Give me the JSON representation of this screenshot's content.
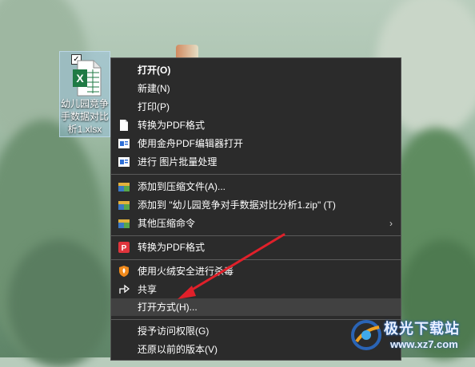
{
  "desktop": {
    "file_name": "幼儿园竞争对手数据对比分析1.xlsx",
    "file_name_lines": [
      "幼儿园竞争",
      "手数据对比",
      "析1.xlsx"
    ],
    "selected_check": "✓"
  },
  "menu": {
    "items": [
      {
        "label": "打开(O)",
        "icon": "none"
      },
      {
        "label": "新建(N)",
        "icon": "none"
      },
      {
        "label": "打印(P)",
        "icon": "none"
      },
      {
        "label": "转换为PDF格式",
        "icon": "document-icon"
      },
      {
        "label": "使用金舟PDF编辑器打开",
        "icon": "pdf-editor-icon"
      },
      {
        "label": "进行 图片批量处理",
        "icon": "image-batch-icon"
      },
      {
        "label": "添加到压缩文件(A)...",
        "icon": "archive-icon"
      },
      {
        "label": "添加到 \"幼儿园竞争对手数据对比分析1.zip\" (T)",
        "icon": "archive-icon"
      },
      {
        "label": "其他压缩命令",
        "icon": "archive-icon"
      },
      {
        "label": "转换为PDF格式",
        "icon": "pdf-red-icon"
      },
      {
        "label": "使用火绒安全进行杀毒",
        "icon": "shield-icon"
      },
      {
        "label": "共享",
        "icon": "share-icon"
      },
      {
        "label": "打开方式(H)...",
        "icon": "none"
      },
      {
        "label": "授予访问权限(G)",
        "icon": "none"
      },
      {
        "label": "还原以前的版本(V)",
        "icon": "none"
      }
    ],
    "submenu_chevron": "›"
  },
  "watermark": {
    "title": "极光下载站",
    "url": "www.xz7.com"
  },
  "colors": {
    "menu_bg": "#2b2b2b",
    "menu_highlight": "#414141",
    "arrow": "#e0202a",
    "excel_green": "#1f7a44"
  }
}
